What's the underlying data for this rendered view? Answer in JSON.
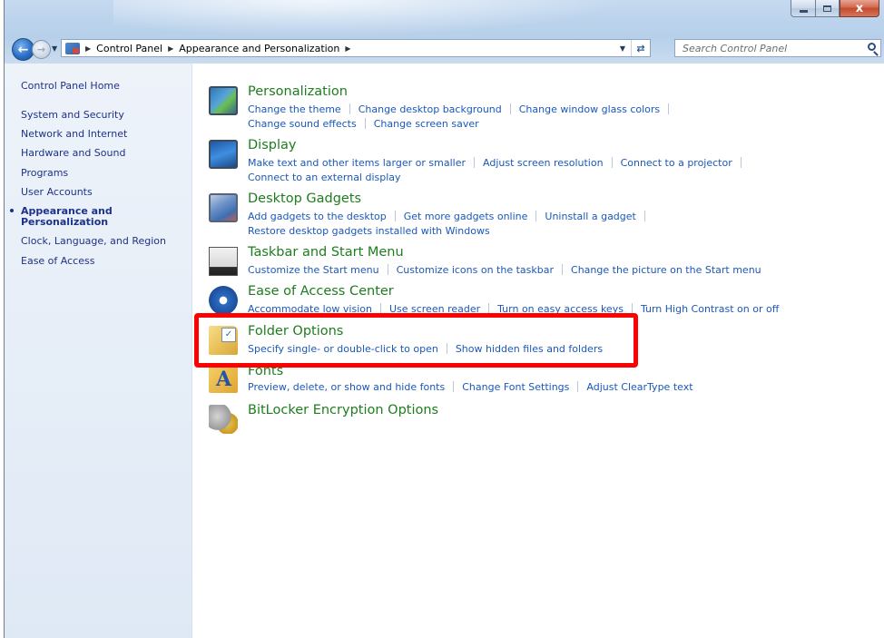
{
  "window": {
    "caption_minimize": "—",
    "caption_maximize": "□",
    "caption_close": "x"
  },
  "nav": {
    "back_icon": "back-arrow-icon",
    "forward_icon": "forward-arrow-icon",
    "breadcrumbs": [
      "Control Panel",
      "Appearance and Personalization"
    ],
    "refresh_icon": "refresh-icon"
  },
  "search": {
    "placeholder": "Search Control Panel",
    "value": ""
  },
  "sidebar": {
    "items": [
      {
        "label": "Control Panel Home"
      },
      {
        "label": "System and Security"
      },
      {
        "label": "Network and Internet"
      },
      {
        "label": "Hardware and Sound"
      },
      {
        "label": "Programs"
      },
      {
        "label": "User Accounts"
      },
      {
        "label_line1": "Appearance and",
        "label_line2": "Personalization",
        "current": true
      },
      {
        "label": "Clock, Language, and Region"
      },
      {
        "label": "Ease of Access"
      }
    ]
  },
  "categories": [
    {
      "title": "Personalization",
      "icon": "personalization-icon",
      "links": [
        "Change the theme",
        "Change desktop background",
        "Change window glass colors",
        "Change sound effects",
        "Change screen saver"
      ]
    },
    {
      "title": "Display",
      "icon": "display-icon",
      "links": [
        "Make text and other items larger or smaller",
        "Adjust screen resolution",
        "Connect to a projector",
        "Connect to an external display"
      ]
    },
    {
      "title": "Desktop Gadgets",
      "icon": "desktop-gadgets-icon",
      "links": [
        "Add gadgets to the desktop",
        "Get more gadgets online",
        "Uninstall a gadget",
        "Restore desktop gadgets installed with Windows"
      ]
    },
    {
      "title": "Taskbar and Start Menu",
      "icon": "taskbar-icon",
      "links": [
        "Customize the Start menu",
        "Customize icons on the taskbar",
        "Change the picture on the Start menu"
      ]
    },
    {
      "title": "Ease of Access Center",
      "icon": "ease-of-access-icon",
      "links": [
        "Accommodate low vision",
        "Use screen reader",
        "Turn on easy access keys",
        "Turn High Contrast on or off"
      ]
    },
    {
      "title": "Folder Options",
      "icon": "folder-options-icon",
      "links": [
        "Specify single- or double-click to open",
        "Show hidden files and folders"
      ]
    },
    {
      "title": "Fonts",
      "icon": "fonts-icon",
      "links": [
        "Preview, delete, or show and hide fonts",
        "Change Font Settings",
        "Adjust ClearType text"
      ]
    },
    {
      "title": "BitLocker Encryption Options",
      "icon": "bitlocker-icon",
      "links": []
    }
  ],
  "colors": {
    "category_title": "#1e7d1e",
    "link": "#1b58b8",
    "sidebar_link": "#1e3287",
    "highlight": "#ff0000"
  }
}
